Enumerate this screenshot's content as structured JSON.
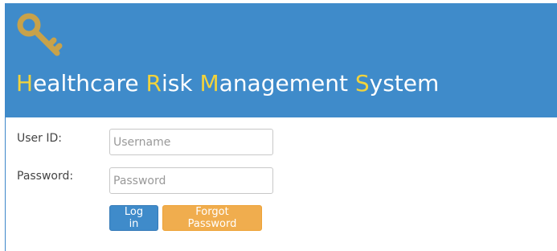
{
  "header": {
    "title_parts": [
      {
        "cap": "H",
        "rest": "ealthcare "
      },
      {
        "cap": "R",
        "rest": "isk "
      },
      {
        "cap": "M",
        "rest": "anagement "
      },
      {
        "cap": "S",
        "rest": "ystem"
      }
    ],
    "icon": "key-icon",
    "icon_color": "#c8a24a",
    "accent_color": "#f2d33c",
    "header_color": "#3f8bca"
  },
  "form": {
    "user_label": "User ID:",
    "user_placeholder": "Username",
    "password_label": "Password:",
    "password_placeholder": "Password",
    "login_label": "Log in",
    "forgot_label": "Forgot Password"
  }
}
